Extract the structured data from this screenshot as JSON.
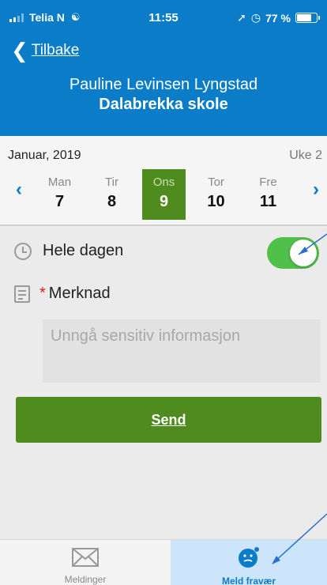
{
  "status": {
    "carrier": "Telia N",
    "time": "11:55",
    "battery": "77 %",
    "battery_level": 0.77
  },
  "header": {
    "back_label": "Tilbake",
    "student_name": "Pauline Levinsen Lyngstad",
    "school_name": "Dalabrekka skole"
  },
  "week": {
    "month": "Januar, 2019",
    "week_number": "Uke 2",
    "days": [
      {
        "name": "Man",
        "number": "7"
      },
      {
        "name": "Tir",
        "number": "8"
      },
      {
        "name": "Ons",
        "number": "9",
        "selected": true
      },
      {
        "name": "Tor",
        "number": "10"
      },
      {
        "name": "Fre",
        "number": "11"
      }
    ]
  },
  "form": {
    "all_day_label": "Hele dagen",
    "all_day_on": true,
    "required_marker": "*",
    "note_label": "Merknad",
    "note_value": "",
    "note_placeholder": "Unngå sensitiv informasjon",
    "send_label": "Send"
  },
  "tabs": [
    {
      "label": "Meldinger",
      "icon": "envelope-icon",
      "active": false
    },
    {
      "label": "Meld fravær",
      "icon": "face-icon",
      "active": true
    }
  ],
  "colors": {
    "header": "#0b7cc7",
    "accent_green": "#4f8b1f",
    "toggle_on": "#4fc04a",
    "active_tab": "#cce5fb",
    "required": "#d0201e"
  }
}
